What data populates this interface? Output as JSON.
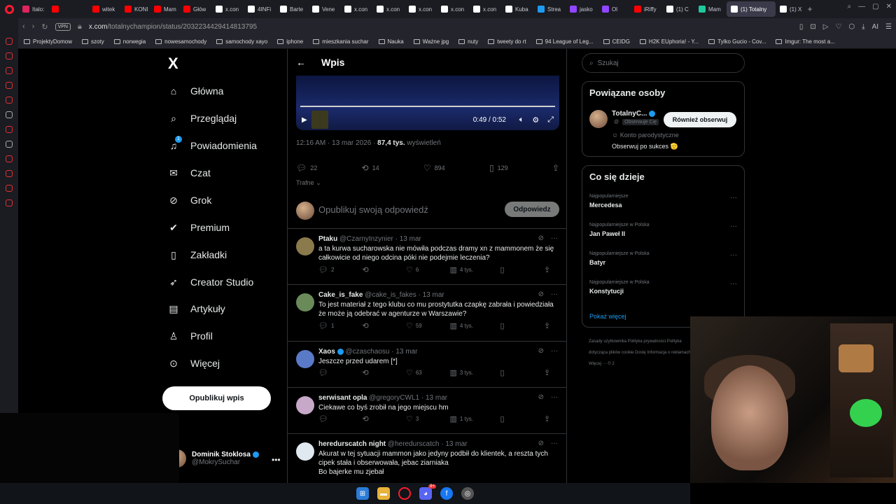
{
  "browser": {
    "tabs": [
      {
        "label": "Italo:",
        "color": "#e0245e"
      },
      {
        "label": "",
        "color": "#ff0000"
      },
      {
        "label": "witek",
        "color": "#ff0000"
      },
      {
        "label": "KONI",
        "color": "#ff0000"
      },
      {
        "label": "Mam",
        "color": "#ff0000"
      },
      {
        "label": "Głów",
        "color": "#ff0000"
      },
      {
        "label": "x.con",
        "color": "#ffffff"
      },
      {
        "label": "4INFi",
        "color": "#ffffff"
      },
      {
        "label": "Barte",
        "color": "#ffffff"
      },
      {
        "label": "Vene",
        "color": "#ffffff"
      },
      {
        "label": "x.con",
        "color": "#ffffff"
      },
      {
        "label": "x.con",
        "color": "#ffffff"
      },
      {
        "label": "x.con",
        "color": "#ffffff"
      },
      {
        "label": "x.con",
        "color": "#ffffff"
      },
      {
        "label": "x.con",
        "color": "#ffffff"
      },
      {
        "label": "Kuba",
        "color": "#ffffff"
      },
      {
        "label": "Strea",
        "color": "#1d9bf0"
      },
      {
        "label": "jasko",
        "color": "#9146ff"
      },
      {
        "label": "Ol",
        "color": "#9146ff"
      },
      {
        "label": "iRiffy",
        "color": "#ff0000"
      },
      {
        "label": "(1) C",
        "color": "#ffffff"
      },
      {
        "label": "Mam",
        "color": "#1ec99b"
      },
      {
        "label": "(1) Totalny",
        "color": "#ffffff",
        "active": true
      },
      {
        "label": "(1) X",
        "color": "#ffffff"
      }
    ],
    "vpn_label": "VPN",
    "url_host": "x.com",
    "url_path": "/totalnychampion/status/2032234429414813795",
    "bookmarks": [
      "ProjektyDomow",
      "szoty",
      "norwegia",
      "nowesamochody",
      "samochody xayo",
      "iphone",
      "mieszkania suchar",
      "Nauka",
      "Ważne jpg",
      "nuty",
      "tweety do rt",
      "94 League of Leg...",
      "CEIDG",
      "H2K EUphoria! - Y...",
      "Tylko Gucio - Cov...",
      "Imgur: The most a..."
    ]
  },
  "nav": {
    "logo": "X",
    "notification_badge": "1",
    "items": [
      {
        "label": "Główna",
        "icon": "home-icon",
        "glyph": "⌂"
      },
      {
        "label": "Przeglądaj",
        "icon": "search-icon",
        "glyph": "⌕"
      },
      {
        "label": "Powiadomienia",
        "icon": "bell-icon",
        "glyph": "♫"
      },
      {
        "label": "Czat",
        "icon": "mail-icon",
        "glyph": "✉"
      },
      {
        "label": "Grok",
        "icon": "grok-icon",
        "glyph": "⊘"
      },
      {
        "label": "Premium",
        "icon": "verified-icon",
        "glyph": "✔"
      },
      {
        "label": "Zakładki",
        "icon": "bookmark-icon",
        "glyph": "▯"
      },
      {
        "label": "Creator Studio",
        "icon": "rocket-icon",
        "glyph": "➶"
      },
      {
        "label": "Artykuły",
        "icon": "article-icon",
        "glyph": "▤"
      },
      {
        "label": "Profil",
        "icon": "person-icon",
        "glyph": "♙"
      },
      {
        "label": "Więcej",
        "icon": "more-circle-icon",
        "glyph": "⊙"
      }
    ],
    "post_button": "Opublikuj wpis",
    "account": {
      "name": "Dominik Stoklosa",
      "handle": "@MokrySuchar",
      "more": "•••"
    }
  },
  "main": {
    "back": "←",
    "title": "Wpis",
    "video": {
      "time": "0:49 / 0:52"
    },
    "meta": {
      "timestamp": "12:16 AM · 13 mar 2026 · ",
      "views": "87,4 tys.",
      "views_label": " wyświetleń"
    },
    "stats": {
      "replies": "22",
      "reposts": "14",
      "likes": "894",
      "bookmarks": "129"
    },
    "sort": "Trafne",
    "reply_placeholder": "Opublikuj swoją odpowiedź",
    "reply_button": "Odpowiedz",
    "replies": [
      {
        "name": "Ptaku",
        "handle": "@CzarnyInzynier",
        "time": " · 13 mar",
        "verified": false,
        "text": "a ta kurwa sucharowska nie mówiła podczas dramy xn z mammonem że się całkowicie od niego odcina póki nie podejmie leczenia?",
        "replies": "2",
        "reposts": "",
        "likes": "6",
        "views": "4 tys.",
        "avatar": "#8a7a4c"
      },
      {
        "name": "Cake_is_fake",
        "handle": "@cake_is_fakes",
        "time": " · 13 mar",
        "verified": false,
        "text": "To jest materiał z tego klubu co mu prostytutka czapkę zabrała i powiedziała że może ją odebrać w agenturze w Warszawie?",
        "replies": "1",
        "reposts": "",
        "likes": "59",
        "views": "4 tys.",
        "avatar": "#6a8a5a"
      },
      {
        "name": "Χaos",
        "handle": "@czaschaosu",
        "time": " · 13 mar",
        "verified": true,
        "text": "Jeszcze przed udarem [*]",
        "replies": "",
        "reposts": "",
        "likes": "63",
        "views": "3 tys.",
        "avatar": "#5a7ac8"
      },
      {
        "name": "serwisant opla",
        "handle": "@gregoryCWL1",
        "time": " · 13 mar",
        "verified": false,
        "text": "Ciekawe co byś zrobił na jego miejscu hm",
        "replies": "",
        "reposts": "",
        "likes": "3",
        "views": "1 tys.",
        "avatar": "#c8a8c8"
      },
      {
        "name": "heredurscatch night",
        "handle": "@heredurscatch",
        "time": " · 13 mar",
        "verified": false,
        "text": "Akurat w tej sytuacji mammon jako jedyny podbił do klientek, a reszta tych cipek stała i obserwowała, jebac ziarniaka\nBo bajerke mu zjebał",
        "replies": "",
        "reposts": "",
        "likes": "",
        "views": "",
        "avatar": "#e0e8f0"
      }
    ]
  },
  "right": {
    "search_placeholder": "Szukaj",
    "related": {
      "title": "Powiązane osoby",
      "name": "TotalnyC...",
      "handle": "@",
      "follows_you": "Obserwuje Cię",
      "follow_button": "Również obserwuj",
      "bio_line1": "Konto parodystyczne",
      "bio_line2": "Obserwuj po sukces 🫡"
    },
    "trending": {
      "title": "Co się dzieje",
      "items": [
        {
          "category": "Najpopularniejsze",
          "name": "Mercedesa"
        },
        {
          "category": "Najpopularniejsze w Polska",
          "name": "Jan Paweł II"
        },
        {
          "category": "Najpopularniejsze w Polska",
          "name": "Batyr"
        },
        {
          "category": "Najpopularniejsze w Polska",
          "name": "Konstytucji"
        }
      ],
      "show_more": "Pokaż więcej"
    },
    "footer": [
      "Zasady użytkownika",
      "Polityka prywatności",
      "Polityka dotycząca plików cookie",
      "Dostę",
      "Informacja o reklamach",
      "Więcej ···",
      "© 2"
    ]
  },
  "taskbar": {
    "icons": [
      "windows-start-icon",
      "file-explorer-icon",
      "opera-icon",
      "discord-icon",
      "facebook-icon",
      "chrome-icon"
    ],
    "discord_badge": "9+"
  },
  "colors": {
    "accent": "#1d9bf0",
    "background": "#000000",
    "browser_red": "#ff1b2d"
  }
}
